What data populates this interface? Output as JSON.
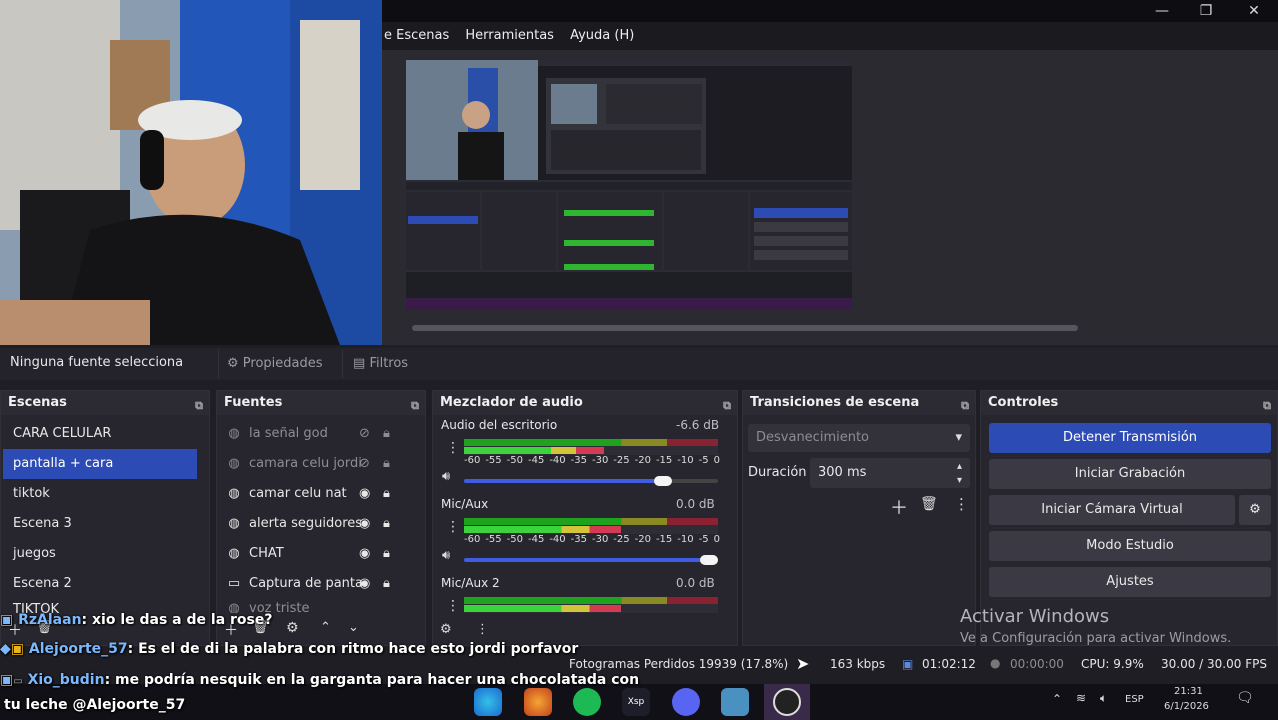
{
  "window": {
    "minimize_label": "—",
    "maximize_label": "❐",
    "close_label": "✕"
  },
  "menu": {
    "items": [
      "e Escenas",
      "Herramientas",
      "Ayuda (H)"
    ]
  },
  "source_bar": {
    "none_selected": "Ninguna fuente selecciona",
    "properties_label": "Propiedades",
    "filters_label": "Filtros"
  },
  "scenes": {
    "title": "Escenas",
    "items": [
      "CARA CELULAR",
      "pantalla + cara",
      "tiktok",
      "Escena 3",
      "juegos",
      "Escena 2",
      "TIKTOK"
    ],
    "selected_index": 1
  },
  "sources": {
    "title": "Fuentes",
    "items": [
      {
        "label": "la señal god",
        "visible": false
      },
      {
        "label": "camara celu jordi",
        "visible": false
      },
      {
        "label": "camar celu nat",
        "visible": true
      },
      {
        "label": "alerta seguidores",
        "visible": true
      },
      {
        "label": "CHAT",
        "visible": true
      },
      {
        "label": "Captura de panta",
        "visible": true
      },
      {
        "label": "voz triste",
        "visible": false
      }
    ]
  },
  "mixer": {
    "title": "Mezclador de audio",
    "channels": [
      {
        "name": "Audio del escritorio",
        "db": "-6.6 dB",
        "level": 0.55,
        "volume": 0.82
      },
      {
        "name": "Mic/Aux",
        "db": "0.0 dB",
        "level": 0.62,
        "volume": 1.0
      },
      {
        "name": "Mic/Aux 2",
        "db": "0.0 dB",
        "level": 0.62,
        "volume": 1.0
      }
    ],
    "ticks": [
      "-60",
      "-55",
      "-50",
      "-45",
      "-40",
      "-35",
      "-30",
      "-25",
      "-20",
      "-15",
      "-10",
      "-5",
      "0"
    ]
  },
  "transitions": {
    "title": "Transiciones de escena",
    "selected": "Desvanecimiento",
    "duration_label": "Duración",
    "duration_value": "300 ms"
  },
  "controls": {
    "title": "Controles",
    "stop_stream": "Detener Transmisión",
    "start_recording": "Iniciar Grabación",
    "start_virtual_camera": "Iniciar Cámara Virtual",
    "studio_mode": "Modo Estudio",
    "settings": "Ajustes"
  },
  "watermark": {
    "title": "Activar Windows",
    "subtitle": "Ve a Configuración para activar Windows."
  },
  "status": {
    "dropped_frames": "Fotogramas Perdidos 19939 (17.8%)",
    "bitrate": "163 kbps",
    "live_time": "01:02:12",
    "rec_time": "00:00:00",
    "cpu": "CPU: 9.9%",
    "fps": "30.00 / 30.00 FPS"
  },
  "chat": [
    {
      "user": "RzAlaan",
      "text": ": xio le das a de la rose?"
    },
    {
      "user": "Alejoorte_57",
      "text": ": Es el de di la palabra con ritmo hace esto jordi porfavor"
    },
    {
      "user": "Xio_budin",
      "text": ": me podría nesquik en la garganta para hacer una chocolatada con"
    },
    {
      "user": "",
      "text": "tu leche @Alejoorte_57"
    }
  ],
  "taskbar": {
    "lang": "ESP",
    "time": "21:31",
    "date": "6/1/2026"
  },
  "colors": {
    "accent": "#2c4bb5",
    "panel": "#27262e",
    "background": "#1f1e25"
  }
}
